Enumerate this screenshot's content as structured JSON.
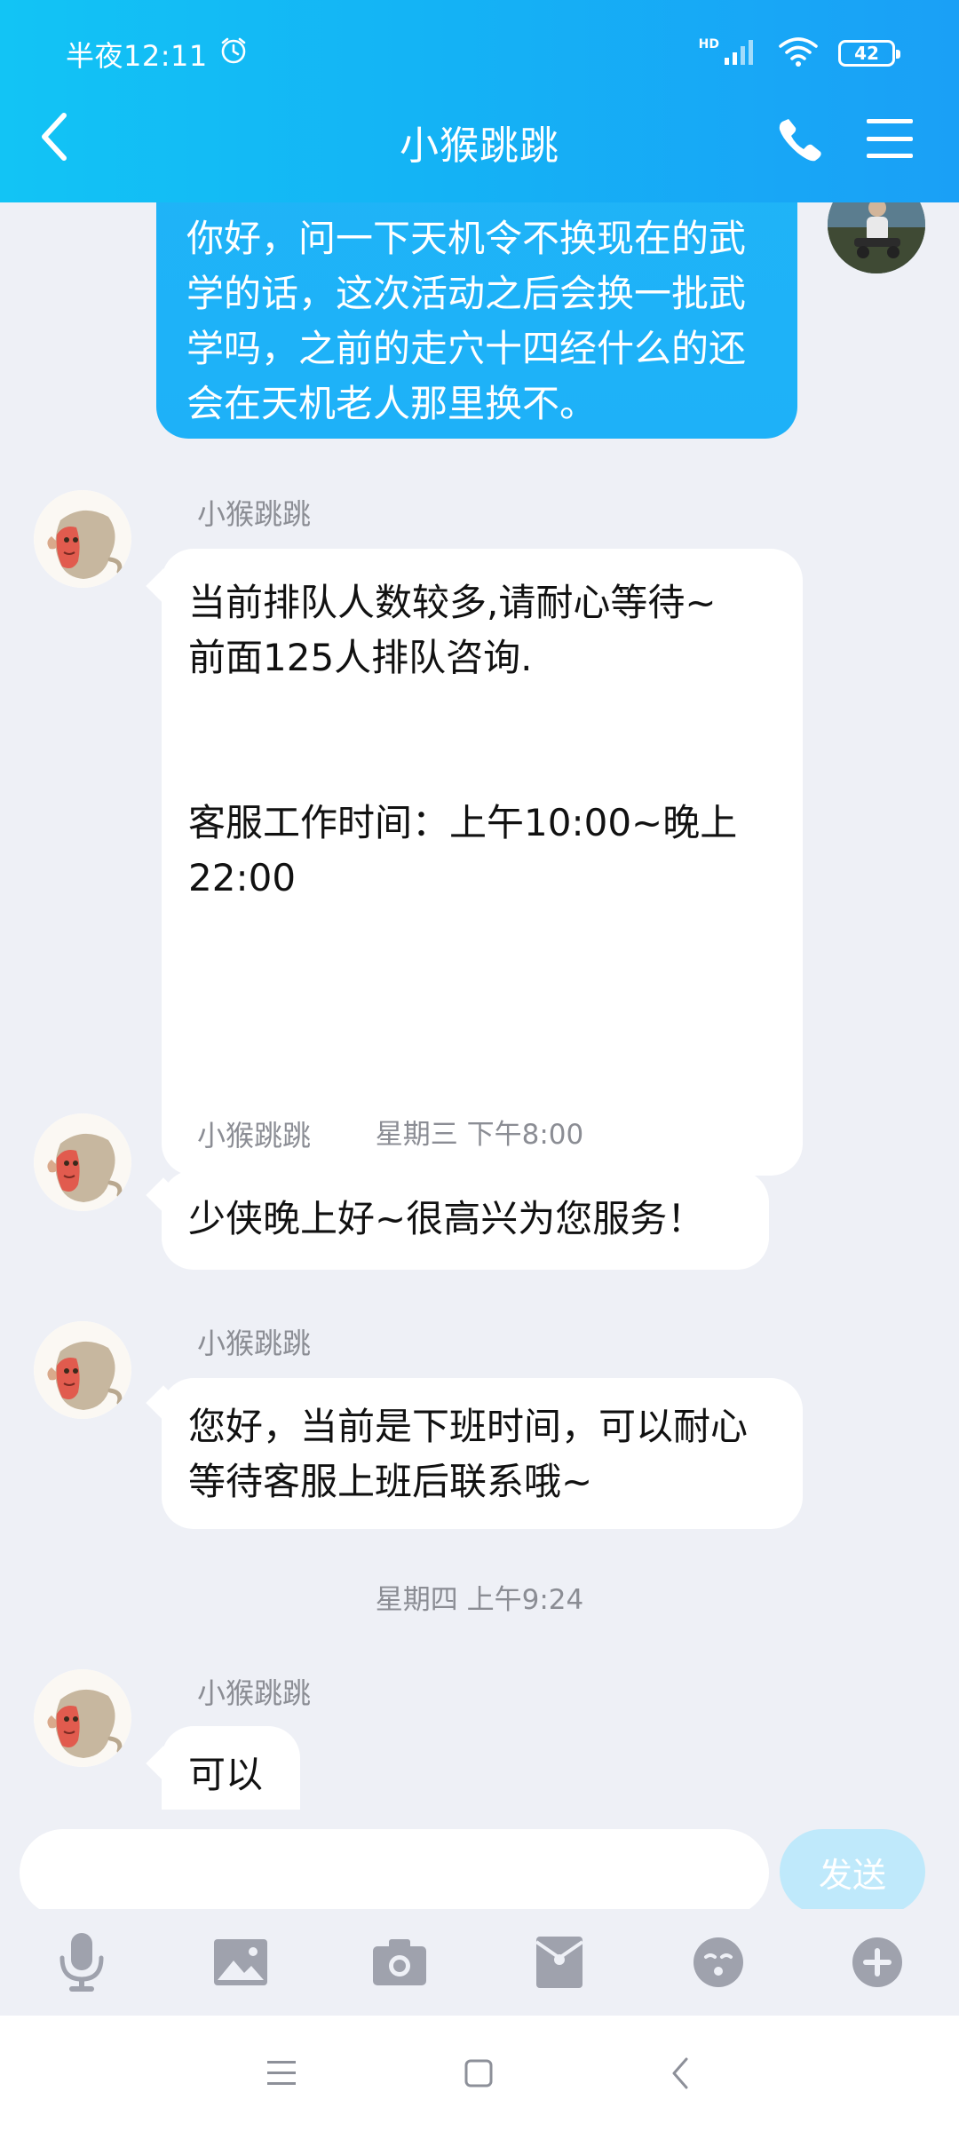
{
  "status_bar": {
    "time": "半夜12:11",
    "network": "HD",
    "battery": "42"
  },
  "nav": {
    "title": "小猴跳跳"
  },
  "messages": [
    {
      "direction": "outgoing",
      "text": "你好，问一下天机令不换现在的武学的话，这次活动之后会换一批武学吗，之前的走穴十四经什么的还会在天机老人那里换不。"
    },
    {
      "direction": "incoming",
      "sender": "小猴跳跳",
      "text": "当前排队人数较多,请耐心等待~\n前面125人排队咨询.\n\n\n客服工作时间：上午10:00~晚上22:00"
    },
    {
      "type": "timestamp",
      "text": "星期三 下午8:00"
    },
    {
      "direction": "incoming",
      "sender": "小猴跳跳",
      "text": "少侠晚上好~很高兴为您服务！"
    },
    {
      "direction": "incoming",
      "sender": "小猴跳跳",
      "text": "您好，当前是下班时间，可以耐心等待客服上班后联系哦~"
    },
    {
      "type": "timestamp",
      "text": "星期四 上午9:24"
    },
    {
      "direction": "incoming",
      "sender": "小猴跳跳",
      "text": "可以"
    }
  ],
  "input": {
    "value": "",
    "send_label": "发送"
  },
  "toolbar": {
    "items": [
      "microphone-icon",
      "image-icon",
      "camera-icon",
      "red-packet-icon",
      "emoji-icon",
      "plus-icon"
    ]
  },
  "system_nav": {
    "items": [
      "menu-icon",
      "home-icon",
      "back-icon"
    ]
  },
  "colors": {
    "header_start": "#12c4f5",
    "header_end": "#1aa0f6",
    "chat_background": "#eef0f6",
    "outgoing_bubble": "#1eb1f8",
    "send_button": "#bfe9fb",
    "icon_gray": "#9fa2ad"
  }
}
